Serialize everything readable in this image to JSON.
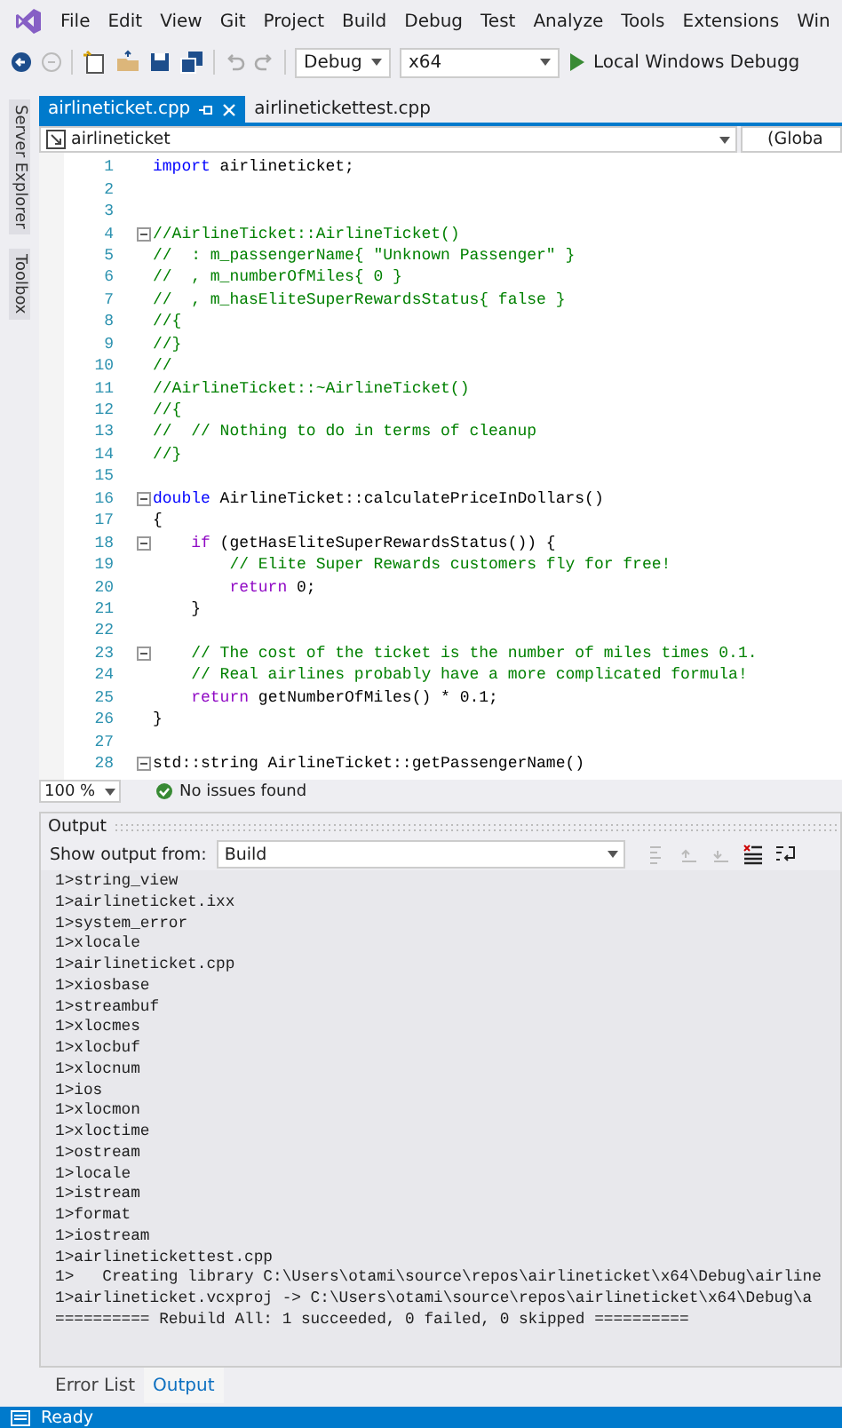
{
  "menu": {
    "items": [
      "File",
      "Edit",
      "View",
      "Git",
      "Project",
      "Build",
      "Debug",
      "Test",
      "Analyze",
      "Tools",
      "Extensions",
      "Win"
    ]
  },
  "toolbar": {
    "configuration": "Debug",
    "platform": "x64",
    "run_label": "Local Windows Debugg"
  },
  "side_rail": [
    "Server Explorer",
    "Toolbox"
  ],
  "editor": {
    "tabs": [
      {
        "label": "airlineticket.cpp",
        "selected": true
      },
      {
        "label": "airlinetickettest.cpp",
        "selected": false
      }
    ],
    "nav": {
      "scope": "airlineticket",
      "members": "(Globa"
    },
    "lines": [
      {
        "number": "1",
        "fold": false,
        "tokens": [
          {
            "kind": "keyword",
            "text": "import"
          },
          {
            "kind": "plain",
            "text": " airlineticket;"
          }
        ]
      },
      {
        "number": "2",
        "fold": false
      },
      {
        "number": "3",
        "fold": false
      },
      {
        "number": "4",
        "fold": true,
        "tokens": [
          {
            "kind": "comment",
            "text": "//AirlineTicket::AirlineTicket()"
          }
        ]
      },
      {
        "number": "5",
        "fold": false,
        "tokens": [
          {
            "kind": "comment",
            "text": "//  : m_passengerName{ \"Unknown Passenger\" }"
          }
        ]
      },
      {
        "number": "6",
        "fold": false,
        "tokens": [
          {
            "kind": "comment",
            "text": "//  , m_numberOfMiles{ 0 }"
          }
        ]
      },
      {
        "number": "7",
        "fold": false,
        "tokens": [
          {
            "kind": "comment",
            "text": "//  , m_hasEliteSuperRewardsStatus{ false }"
          }
        ]
      },
      {
        "number": "8",
        "fold": false,
        "tokens": [
          {
            "kind": "comment",
            "text": "//{"
          }
        ]
      },
      {
        "number": "9",
        "fold": false,
        "tokens": [
          {
            "kind": "comment",
            "text": "//}"
          }
        ]
      },
      {
        "number": "10",
        "fold": false,
        "tokens": [
          {
            "kind": "comment",
            "text": "//"
          }
        ]
      },
      {
        "number": "11",
        "fold": false,
        "tokens": [
          {
            "kind": "comment",
            "text": "//AirlineTicket::~AirlineTicket()"
          }
        ]
      },
      {
        "number": "12",
        "fold": false,
        "tokens": [
          {
            "kind": "comment",
            "text": "//{"
          }
        ]
      },
      {
        "number": "13",
        "fold": false,
        "tokens": [
          {
            "kind": "comment",
            "text": "//  // Nothing to do in terms of cleanup"
          }
        ]
      },
      {
        "number": "14",
        "fold": false,
        "tokens": [
          {
            "kind": "comment",
            "text": "//}"
          }
        ]
      },
      {
        "number": "15",
        "fold": false
      },
      {
        "number": "16",
        "fold": true,
        "tokens": [
          {
            "kind": "keyword",
            "text": "double"
          },
          {
            "kind": "plain",
            "text": " AirlineTicket::calculatePriceInDollars()"
          }
        ]
      },
      {
        "number": "17",
        "fold": false,
        "tokens": [
          {
            "kind": "plain",
            "text": "{"
          }
        ]
      },
      {
        "number": "18",
        "fold": true,
        "tokens": [
          {
            "kind": "control",
            "text": "    if"
          },
          {
            "kind": "plain",
            "text": " (getHasEliteSuperRewardsStatus()) {"
          }
        ]
      },
      {
        "number": "19",
        "fold": false,
        "tokens": [
          {
            "kind": "comment",
            "text": "        // Elite Super Rewards customers fly for free!"
          }
        ]
      },
      {
        "number": "20",
        "fold": false,
        "tokens": [
          {
            "kind": "control",
            "text": "        return"
          },
          {
            "kind": "plain",
            "text": " 0;"
          }
        ]
      },
      {
        "number": "21",
        "fold": false,
        "tokens": [
          {
            "kind": "plain",
            "text": "    }"
          }
        ]
      },
      {
        "number": "22",
        "fold": false
      },
      {
        "number": "23",
        "fold": true,
        "tokens": [
          {
            "kind": "comment",
            "text": "    // The cost of the ticket is the number of miles times 0.1."
          }
        ]
      },
      {
        "number": "24",
        "fold": false,
        "tokens": [
          {
            "kind": "comment",
            "text": "    // Real airlines probably have a more complicated formula!"
          }
        ]
      },
      {
        "number": "25",
        "fold": false,
        "tokens": [
          {
            "kind": "control",
            "text": "    return"
          },
          {
            "kind": "plain",
            "text": " getNumberOfMiles() * 0.1;"
          }
        ]
      },
      {
        "number": "26",
        "fold": false,
        "tokens": [
          {
            "kind": "plain",
            "text": "}"
          }
        ]
      },
      {
        "number": "27",
        "fold": false
      },
      {
        "number": "28",
        "fold": true,
        "tokens": [
          {
            "kind": "plain",
            "text": "std::string AirlineTicket::getPassengerName()"
          }
        ]
      }
    ],
    "zoom": "100 %",
    "issues": "No issues found"
  },
  "output": {
    "title": "Output",
    "source_label": "Show output from:",
    "source": "Build",
    "lines": [
      "1>string_view",
      "1>airlineticket.ixx",
      "1>system_error",
      "1>xlocale",
      "1>airlineticket.cpp",
      "1>xiosbase",
      "1>streambuf",
      "1>xlocmes",
      "1>xlocbuf",
      "1>xlocnum",
      "1>ios",
      "1>xlocmon",
      "1>xloctime",
      "1>ostream",
      "1>locale",
      "1>istream",
      "1>format",
      "1>iostream",
      "1>airlinetickettest.cpp",
      "1>   Creating library C:\\Users\\otami\\source\\repos\\airlineticket\\x64\\Debug\\airline",
      "1>airlineticket.vcxproj -> C:\\Users\\otami\\source\\repos\\airlineticket\\x64\\Debug\\a",
      "========== Rebuild All: 1 succeeded, 0 failed, 0 skipped =========="
    ]
  },
  "bottom_tabs": [
    {
      "label": "Error List",
      "selected": false
    },
    {
      "label": "Output",
      "selected": true
    }
  ],
  "status_bar": {
    "text": "Ready"
  }
}
